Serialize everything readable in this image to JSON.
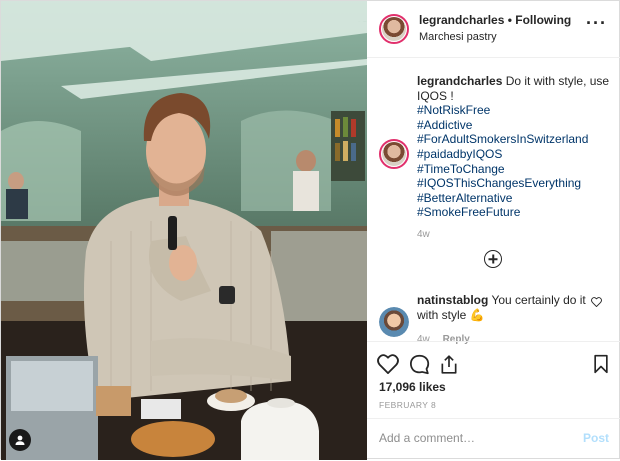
{
  "header": {
    "username": "legrandcharles",
    "separator": "•",
    "follow_status": "Following",
    "location": "Marchesi pastry",
    "more_icon": "more-horizontal-icon"
  },
  "caption": {
    "username": "legrandcharles",
    "text": "Do it with style, use IQOS !",
    "hashtags": [
      "#NotRiskFree",
      "#Addictive",
      "#ForAdultSmokersInSwitzerland",
      "#paidadbyIQOS",
      "#TimeToChange",
      "#IQOSThisChangesEverything",
      "#BetterAlternative",
      "#SmokeFreeFuture"
    ],
    "time": "4w"
  },
  "load_more_icon": "plus-circle-icon",
  "comment": {
    "username": "natinstablog",
    "text": "You certainly do it with style",
    "emoji": "💪",
    "time": "4w",
    "reply_label": "Reply"
  },
  "actions": {
    "icons": [
      "heart-icon",
      "comment-icon",
      "share-icon",
      "bookmark-icon"
    ],
    "likes": "17,096 likes",
    "date": "FEBRUARY 8"
  },
  "add_comment": {
    "placeholder": "Add a comment…",
    "post_label": "Post"
  },
  "colors": {
    "hashtag": "#003569",
    "post_disabled": "#b2dffc",
    "muted": "#999999",
    "story_ring": "#e1306c"
  }
}
